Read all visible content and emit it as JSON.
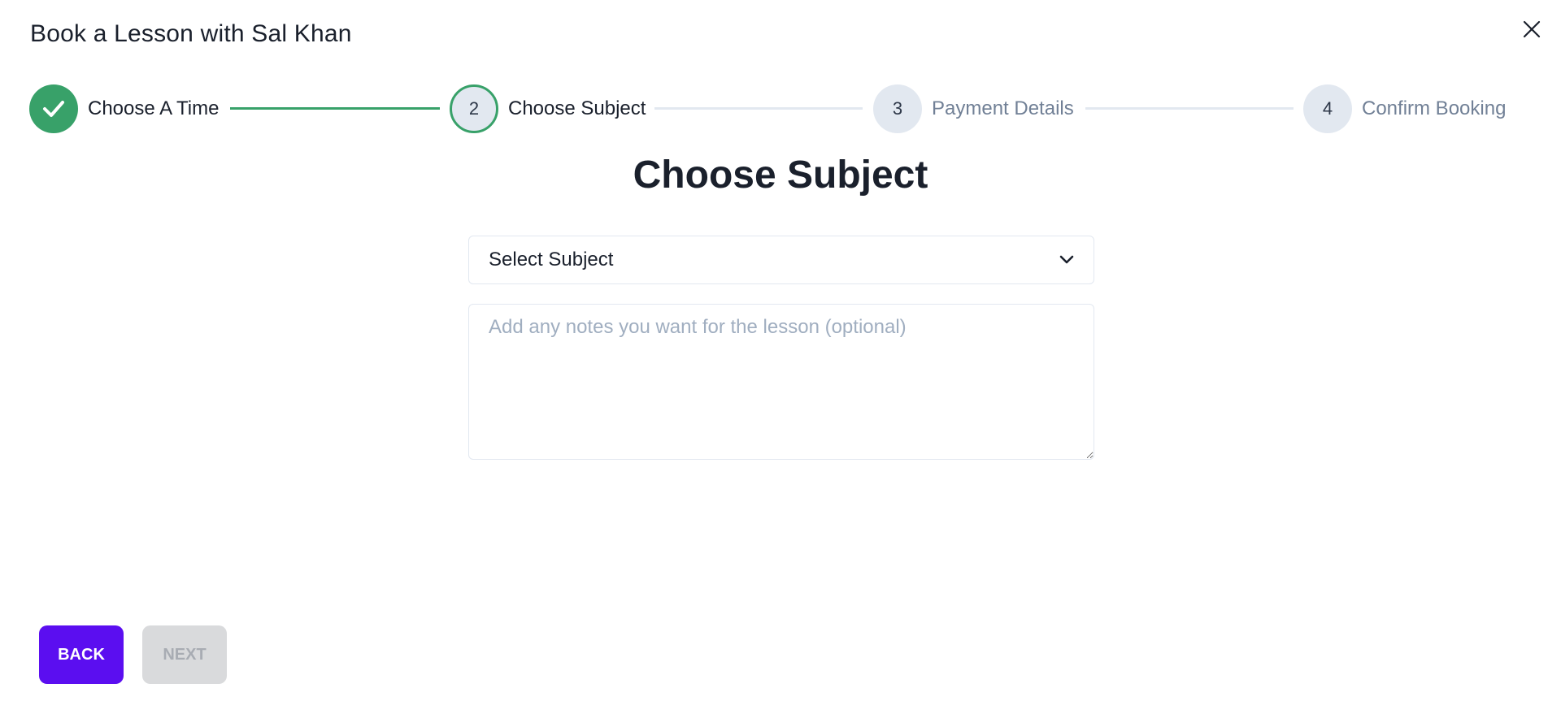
{
  "dialog": {
    "title": "Book a Lesson with Sal Khan",
    "close_icon": "close-icon"
  },
  "stepper": {
    "steps": [
      {
        "number": "1",
        "label": "Choose A Time",
        "state": "complete",
        "icon": "check-icon"
      },
      {
        "number": "2",
        "label": "Choose Subject",
        "state": "active"
      },
      {
        "number": "3",
        "label": "Payment Details",
        "state": "pending"
      },
      {
        "number": "4",
        "label": "Confirm Booking",
        "state": "pending"
      }
    ]
  },
  "main": {
    "heading": "Choose Subject",
    "subject_select": {
      "selected": "Select Subject",
      "icon": "chevron-down-icon"
    },
    "notes": {
      "value": "",
      "placeholder": "Add any notes you want for the lesson (optional)"
    }
  },
  "footer": {
    "back_label": "BACK",
    "next_label": "NEXT"
  },
  "colors": {
    "accent": "#5b0ef0",
    "success": "#38a169",
    "step_pending_bg": "#e2e8f0",
    "disabled_bg": "#d9dadc",
    "disabled_text": "#a8acb3"
  }
}
